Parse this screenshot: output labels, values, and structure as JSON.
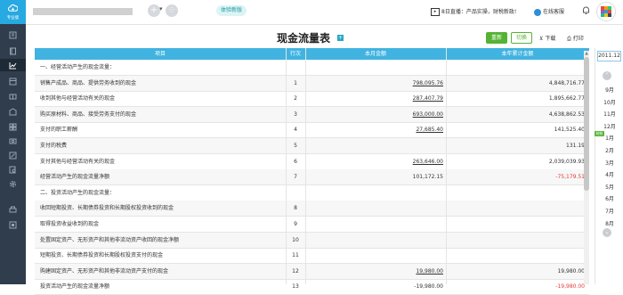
{
  "logo": {
    "text": "专业版"
  },
  "header": {
    "try_new_label": "体验新版",
    "live_label": "8日直播：产品实操，财税新政!",
    "service_label": "在线客服"
  },
  "page": {
    "title": "现金流量表",
    "title_badge": "+",
    "save_label": "重新",
    "reset_label": "切换",
    "download_label": "下载",
    "print_label": "打印"
  },
  "table": {
    "columns": [
      "项目",
      "行次",
      "本月金额",
      "本年累计金额"
    ],
    "rows": [
      {
        "item": "一、经营活动产生的现金流量：",
        "no": "",
        "month": "",
        "year": ""
      },
      {
        "item": "销售产成品、商品、提供劳务收到的现金",
        "no": "1",
        "month": "798,095.76",
        "year": "4,848,716.77"
      },
      {
        "item": "收到其他与经营活动有关的现金",
        "no": "2",
        "month": "287,407.79",
        "year": "1,895,662.77"
      },
      {
        "item": "购买原材料、商品、接受劳务支付的现金",
        "no": "3",
        "month": "693,000.00",
        "year": "4,638,862.53"
      },
      {
        "item": "支付的职工薪酬",
        "no": "4",
        "month": "27,685.40",
        "year": "141,525.40"
      },
      {
        "item": "支付的税费",
        "no": "5",
        "month": "",
        "year": "131.19"
      },
      {
        "item": "支付其他与经营活动有关的现金",
        "no": "6",
        "month": "263,646.00",
        "year": "2,039,039.93"
      },
      {
        "item": "经营活动产生的现金流量净额",
        "no": "7",
        "month": "101,172.15",
        "year": "-75,179.51"
      },
      {
        "item": "二、投资活动产生的现金流量：",
        "no": "",
        "month": "",
        "year": ""
      },
      {
        "item": "收回短期投资、长期债券投资和长期股权投资收到的现金",
        "no": "8",
        "month": "",
        "year": ""
      },
      {
        "item": "取得投资收益收到的现金",
        "no": "9",
        "month": "",
        "year": ""
      },
      {
        "item": "处置固定资产、无形资产和其他非流动资产收回的现金净额",
        "no": "10",
        "month": "",
        "year": ""
      },
      {
        "item": "短期投资、长期债券投资和长期股权投资支付的现金",
        "no": "11",
        "month": "",
        "year": ""
      },
      {
        "item": "购建固定资产、无形资产和其他非流动资产支付的现金",
        "no": "12",
        "month": "19,980.00",
        "year": "19,980.00"
      },
      {
        "item": "投资活动产生的现金流量净额",
        "no": "13",
        "month": "-19,980.00",
        "year": "-19,980.00"
      }
    ]
  },
  "month_picker": {
    "year": "2011.12",
    "tag": "结账",
    "months": [
      "9月",
      "10月",
      "11月",
      "12月",
      "1月",
      "2月",
      "3月",
      "4月",
      "5月",
      "6月",
      "7月",
      "8月"
    ]
  },
  "colors": {
    "sidebar": "#2f3d4c",
    "logo": "#27a9e1",
    "table_header": "#40b3e0",
    "accent_green": "#55b334",
    "negative": "#e23b3b"
  }
}
